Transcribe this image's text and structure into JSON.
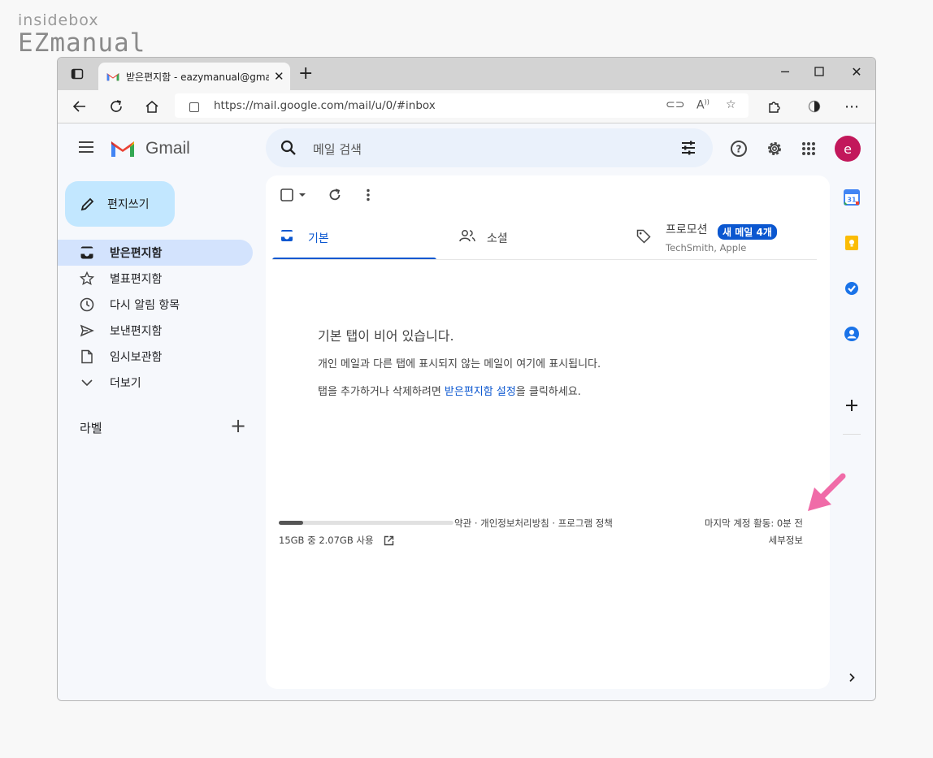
{
  "watermark": {
    "line1": "insidebox",
    "line2": "EZmanual"
  },
  "browser": {
    "tab_title": "받은편지함 - eazymanual@gmail.com - Gmail",
    "url": "https://mail.google.com/mail/u/0/#inbox"
  },
  "gmail": {
    "brand": "Gmail",
    "search_placeholder": "메일 검색",
    "avatar_letter": "e",
    "compose_label": "편지쓰기",
    "sidebar": {
      "items": [
        {
          "label": "받은편지함",
          "icon": "inbox-icon",
          "active": true
        },
        {
          "label": "별표편지함",
          "icon": "star-icon"
        },
        {
          "label": "다시 알림 항목",
          "icon": "clock-icon"
        },
        {
          "label": "보낸편지함",
          "icon": "send-icon"
        },
        {
          "label": "임시보관함",
          "icon": "draft-icon"
        },
        {
          "label": "더보기",
          "icon": "chevron-down-icon"
        }
      ],
      "labels_heading": "라벨"
    },
    "tabs": [
      {
        "label": "기본",
        "icon": "inbox-tab-icon",
        "active": true
      },
      {
        "label": "소셜",
        "icon": "people-icon"
      },
      {
        "label": "프로모션",
        "icon": "tag-icon",
        "badge": "새 메일 4개",
        "subtitle": "TechSmith, Apple"
      }
    ],
    "empty": {
      "heading": "기본 탭이 비어 있습니다.",
      "line1": "개인 메일과 다른 탭에 표시되지 않는 메일이 여기에 표시됩니다.",
      "line2_pre": "탭을 추가하거나 삭제하려면 ",
      "line2_link": "받은편지함 설정",
      "line2_post": "을 클릭하세요."
    },
    "footer": {
      "storage_text": "15GB 중 2.07GB 사용",
      "storage_fraction": 0.138,
      "policy": "약관 · 개인정보처리방침 · 프로그램 정책",
      "activity": "마지막 계정 활동: 0분 전",
      "details": "세부정보"
    }
  },
  "colors": {
    "accent": "#0b57d0",
    "compose_bg": "#c2e7ff",
    "active_nav": "#d3e3fd",
    "avatar": "#c2185b",
    "annotation_arrow": "#f06ba8"
  }
}
